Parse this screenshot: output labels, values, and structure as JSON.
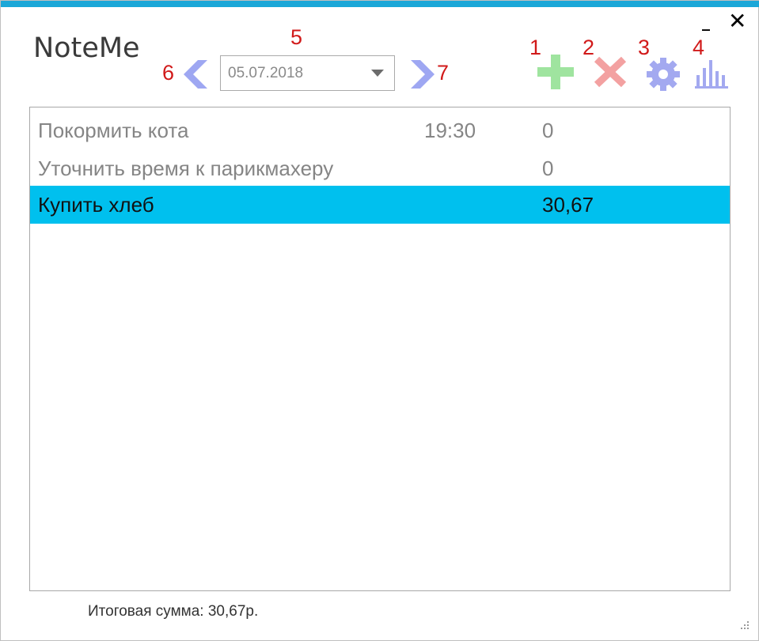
{
  "window": {
    "title": "NoteMe",
    "minimize_label": "_",
    "close_label": "✕"
  },
  "annotations": [
    "1",
    "2",
    "3",
    "4",
    "5",
    "6",
    "7"
  ],
  "date_nav": {
    "prev_icon": "chevron-left-icon",
    "next_icon": "chevron-right-icon",
    "selected_date": "05.07.2018"
  },
  "toolbar": {
    "add_icon": "plus-icon",
    "delete_icon": "x-icon",
    "settings_icon": "gear-icon",
    "stats_icon": "bar-chart-icon"
  },
  "colors": {
    "accent_bar": "#1ba7d8",
    "selection": "#00c0ee",
    "nav_arrow": "#9ea7f2",
    "add": "#9fe49f",
    "delete": "#f3a1a1",
    "settings": "#a3a9f0",
    "annotation": "#d11a1a"
  },
  "notes": [
    {
      "title": "Покормить кота",
      "time": "19:30",
      "sum": "0",
      "selected": false
    },
    {
      "title": "Уточнить время к парикмахеру",
      "time": "",
      "sum": "0",
      "selected": false
    },
    {
      "title": "Купить хлеб",
      "time": "",
      "sum": "30,67",
      "selected": true
    }
  ],
  "footer": {
    "total_text": "Итоговая сумма: 30,67р."
  }
}
